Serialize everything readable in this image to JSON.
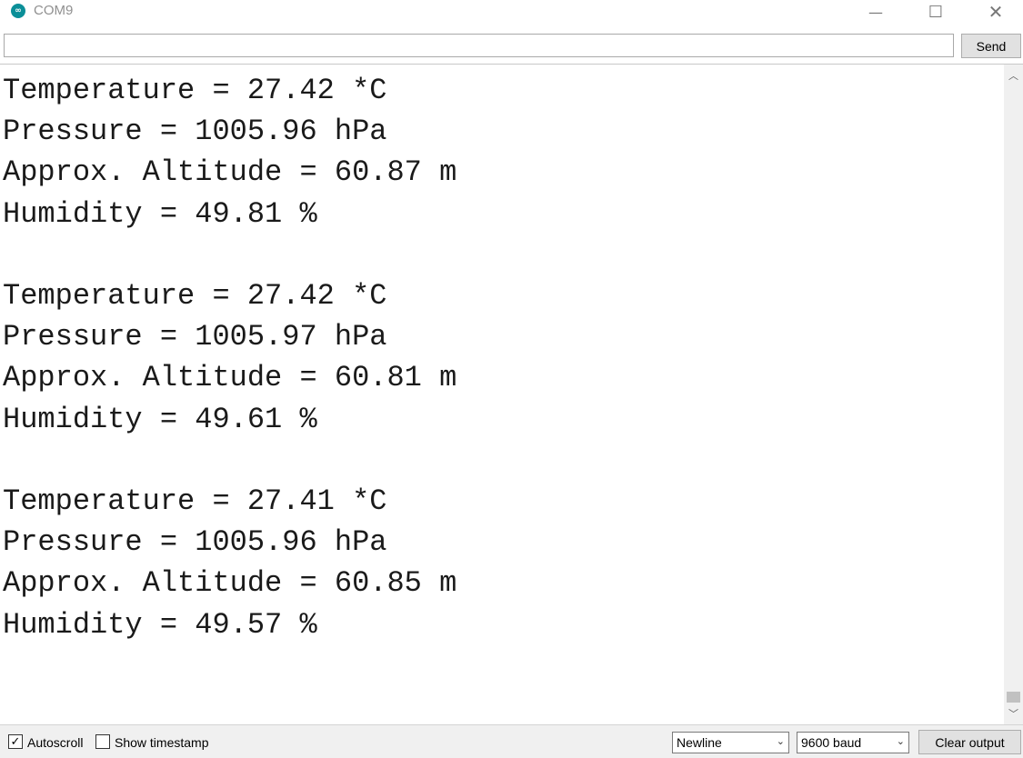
{
  "window": {
    "title": "COM9",
    "app_icon_glyph": "∞",
    "minimize_glyph": "—",
    "maximize_glyph": "☐",
    "close_glyph": "✕"
  },
  "send_bar": {
    "input_value": "",
    "send_label": "Send"
  },
  "output": {
    "lines": [
      "Temperature = 27.42 *C",
      "Pressure = 1005.96 hPa",
      "Approx. Altitude = 60.87 m",
      "Humidity = 49.81 %",
      "",
      "Temperature = 27.42 *C",
      "Pressure = 1005.97 hPa",
      "Approx. Altitude = 60.81 m",
      "Humidity = 49.61 %",
      "",
      "Temperature = 27.41 *C",
      "Pressure = 1005.96 hPa",
      "Approx. Altitude = 60.85 m",
      "Humidity = 49.57 %"
    ]
  },
  "scrollbar": {
    "up_glyph": "︿",
    "down_glyph": "﹀"
  },
  "bottom_bar": {
    "autoscroll_label": "Autoscroll",
    "autoscroll_checked": true,
    "autoscroll_glyph": "✓",
    "timestamp_label": "Show timestamp",
    "timestamp_checked": false,
    "line_ending_value": "Newline",
    "baud_value": "9600 baud",
    "dropdown_glyph": "⌄",
    "clear_label": "Clear output"
  },
  "colors": {
    "app_icon": "#0b8f98",
    "button_face": "#e1e1e1",
    "bottom_bar": "#f0f0f0"
  },
  "icons": {
    "app": "arduino-icon",
    "minimize": "minimize-icon",
    "maximize": "maximize-icon",
    "close": "close-icon",
    "scroll_up": "chevron-up-icon",
    "scroll_down": "chevron-down-icon",
    "dropdown": "chevron-down-icon",
    "checkmark": "checkmark-icon"
  }
}
